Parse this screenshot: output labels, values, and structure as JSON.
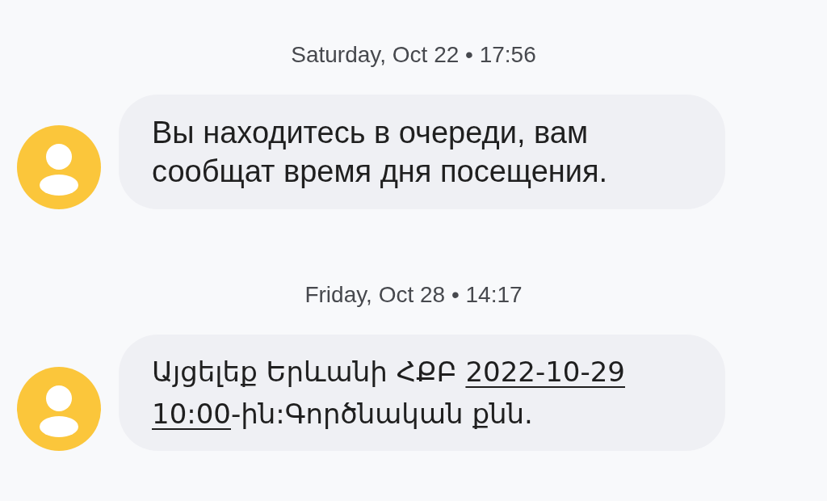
{
  "messages": [
    {
      "timestamp": "Saturday, Oct 22 • 17:56",
      "segments": [
        {
          "kind": "text",
          "text": "Вы находитесь в очереди, вам сообщат время дня посещения."
        }
      ]
    },
    {
      "timestamp": "Friday, Oct 28 • 14:17",
      "segments": [
        {
          "kind": "text",
          "text": "Այցելեք Երևանի ՀՔԲ "
        },
        {
          "kind": "link",
          "parts": [
            "2022-10-29",
            "10:00"
          ]
        },
        {
          "kind": "text",
          "text": "-ին:Գործնական քնն."
        }
      ]
    }
  ]
}
